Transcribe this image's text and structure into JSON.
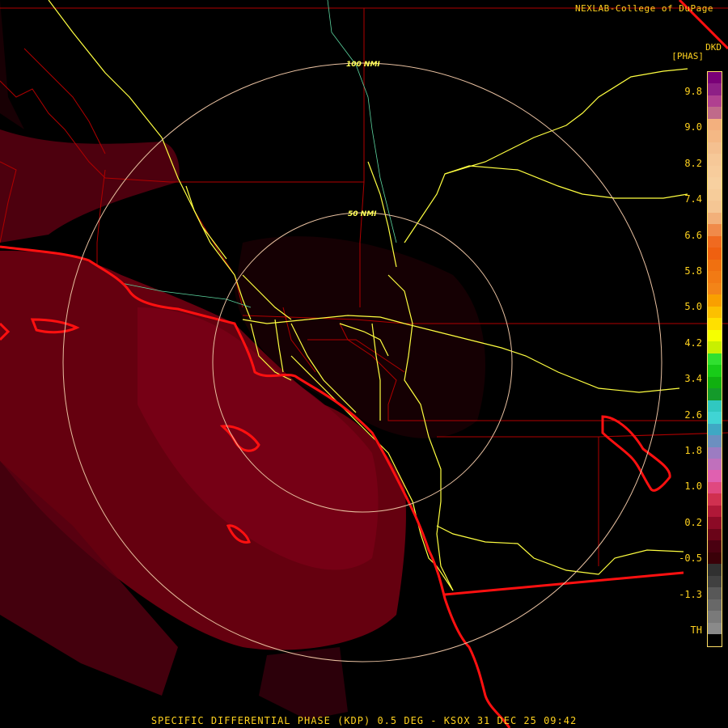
{
  "brand": "NEXLAB-College of DuPage",
  "product": {
    "code": "DKD",
    "unit": "[PHAS]"
  },
  "rings": [
    {
      "label": "100 NMI"
    },
    {
      "label": "50 NMI"
    }
  ],
  "legend": {
    "ticks": [
      "9.8",
      "9.0",
      "8.2",
      "7.4",
      "6.6",
      "5.8",
      "5.0",
      "4.2",
      "3.4",
      "2.6",
      "1.8",
      "1.0",
      "0.2",
      "-0.5",
      "-1.3",
      "TH"
    ],
    "colors": [
      "#7a0078",
      "#8e1f86",
      "#b04090",
      "#c06a8a",
      "#f3b07e",
      "#f4b885",
      "#f4c090",
      "#f6c898",
      "#f7cc9c",
      "#f7d0a0",
      "#f6cc9a",
      "#f5c694",
      "#f2b07a",
      "#f08a4a",
      "#f06a20",
      "#ef6010",
      "#f07010",
      "#f27a14",
      "#f38418",
      "#f9a000",
      "#fcc000",
      "#ffe000",
      "#f6ff00",
      "#c8f000",
      "#30e030",
      "#18cc18",
      "#10b010",
      "#149a2a",
      "#30c8c0",
      "#40d4d4",
      "#3fa8c4",
      "#6c8fc0",
      "#9c7cc2",
      "#c070bc",
      "#e060b0",
      "#e04880",
      "#d03050",
      "#b01838",
      "#8c0a26",
      "#6a0418",
      "#4a0010",
      "#3a0008",
      "#303030",
      "#404040",
      "#585858",
      "#686868",
      "#7a7a7a",
      "#8a8a8a",
      "#000000"
    ]
  },
  "footer": "SPECIFIC DIFFERENTIAL PHASE (KDP) 0.5 DEG - KSOX 31 DEC 25 09:42"
}
